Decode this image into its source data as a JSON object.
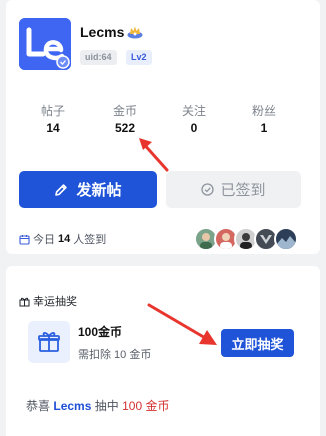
{
  "profile": {
    "avatar_letters": "Le",
    "username": "Lecms",
    "uid": "uid:64",
    "level": "Lv2",
    "vip_icon": "crown-badge-icon"
  },
  "stats": [
    {
      "label": "帖子",
      "value": "14"
    },
    {
      "label": "金币",
      "value": "522"
    },
    {
      "label": "关注",
      "value": "0"
    },
    {
      "label": "粉丝",
      "value": "1"
    }
  ],
  "actions": {
    "post_label": "发新帖",
    "post_icon": "pencil-icon",
    "checked_label": "已签到",
    "checked_icon": "check-circle-icon"
  },
  "checkin": {
    "prefix": "今日",
    "count": "14",
    "suffix": "人签到",
    "icon": "calendar-icon"
  },
  "lottery": {
    "title": "幸运抽奖",
    "title_icon": "gift-icon",
    "prize_name": "100金币",
    "prize_cost": "需扣除 10 金币",
    "draw_label": "立即抽奖",
    "winner_prefix": "恭喜",
    "winner_name": "Lecms",
    "winner_mid": "抽中",
    "winner_prize": "100 金币"
  },
  "colors": {
    "primary": "#1f54d8",
    "accent_red": "#d43030",
    "annotation_arrow": "#e8352d"
  }
}
